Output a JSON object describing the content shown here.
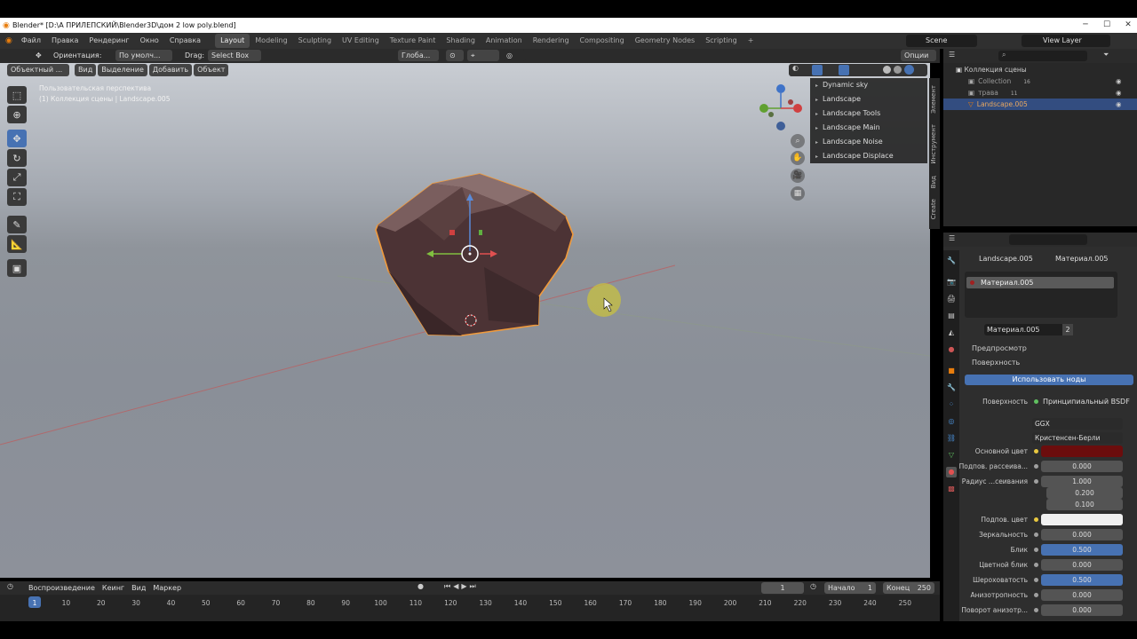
{
  "window": {
    "title": "Blender* [D:\\А ПРИЛЕПСКИЙ\\Blender3D\\дом 2 low poly.blend]"
  },
  "menu": {
    "items": [
      "Файл",
      "Правка",
      "Рендеринг",
      "Окно",
      "Справка"
    ],
    "workspaces": [
      "Layout",
      "Modeling",
      "Sculpting",
      "UV Editing",
      "Texture Paint",
      "Shading",
      "Animation",
      "Rendering",
      "Compositing",
      "Geometry Nodes",
      "Scripting"
    ],
    "add_tab": "+",
    "scene": "Scene",
    "view_layer": "View Layer"
  },
  "viewport_header": {
    "orientation_label": "Ориентация:",
    "orientation_value": "По умолч...",
    "drag_label": "Drag:",
    "drag_value": "Select Box",
    "transform_space": "Глоба...",
    "mode": "Объектный ...",
    "menus": [
      "Вид",
      "Выделение",
      "Добавить",
      "Объект"
    ],
    "options": "Опции"
  },
  "viewport": {
    "perspective_text": "Пользовательская перспектива",
    "collection_text": "(1) Коллекция сцены | Landscape.005",
    "n_panel_items": [
      "Dynamic sky",
      "Landscape",
      "Landscape Tools",
      "Landscape Main",
      "Landscape Noise",
      "Landscape Displace"
    ],
    "side_tabs": [
      "Элемент",
      "Инструмент",
      "Вид",
      "Create"
    ],
    "mesh_color": "#5a3c3c",
    "outline_color": "#f09a3c"
  },
  "outliner": {
    "root": "Коллекция сцены",
    "items": [
      {
        "name": "Collection",
        "badge": "16"
      },
      {
        "name": "трава",
        "badge": "11"
      },
      {
        "name": "Landscape.005",
        "badge": ""
      }
    ]
  },
  "properties": {
    "object_name": "Landscape.005",
    "material_name_header": "Материал.005",
    "slot_name": "Материал.005",
    "material_field": "Материал.005",
    "users": "2",
    "section_preview": "Предпросмотр",
    "section_surface": "Поверхность",
    "use_nodes_button": "Использовать ноды",
    "surface_label": "Поверхность",
    "surface_value": "Принципиальный BSDF",
    "distribution": "GGX",
    "subsurface_method": "Кристенсен-Берли",
    "rows": [
      {
        "label": "Основной цвет",
        "value": "",
        "kind": "color",
        "color": "#6b0d0d"
      },
      {
        "label": "Подпов. рассеива...",
        "value": "0.000",
        "kind": "num"
      },
      {
        "label": "Радиус ...сеивания",
        "value": "1.000",
        "kind": "num"
      },
      {
        "label": "",
        "value": "0.200",
        "kind": "num"
      },
      {
        "label": "",
        "value": "0.100",
        "kind": "num"
      },
      {
        "label": "Подпов. цвет",
        "value": "",
        "kind": "color",
        "color": "#f0f0f0"
      },
      {
        "label": "Зеркальность",
        "value": "0.000",
        "kind": "num"
      },
      {
        "label": "Блик",
        "value": "0.500",
        "kind": "blue"
      },
      {
        "label": "Цветной блик",
        "value": "0.000",
        "kind": "num"
      },
      {
        "label": "Шероховатость",
        "value": "0.500",
        "kind": "blue"
      },
      {
        "label": "Анизотропность",
        "value": "0.000",
        "kind": "num"
      },
      {
        "label": "Поворот анизотр...",
        "value": "0.000",
        "kind": "num"
      }
    ]
  },
  "timeline": {
    "menus": [
      "Воспроизведение",
      "Кеинг",
      "Вид",
      "Маркер"
    ],
    "current_frame": "1",
    "start_label": "Начало",
    "start_value": "1",
    "end_label": "Конец",
    "end_value": "250",
    "ticks": [
      "1",
      "10",
      "20",
      "30",
      "40",
      "50",
      "60",
      "70",
      "80",
      "90",
      "100",
      "110",
      "120",
      "130",
      "140",
      "150",
      "160",
      "170",
      "180",
      "190",
      "200",
      "210",
      "220",
      "230",
      "240",
      "250"
    ]
  }
}
